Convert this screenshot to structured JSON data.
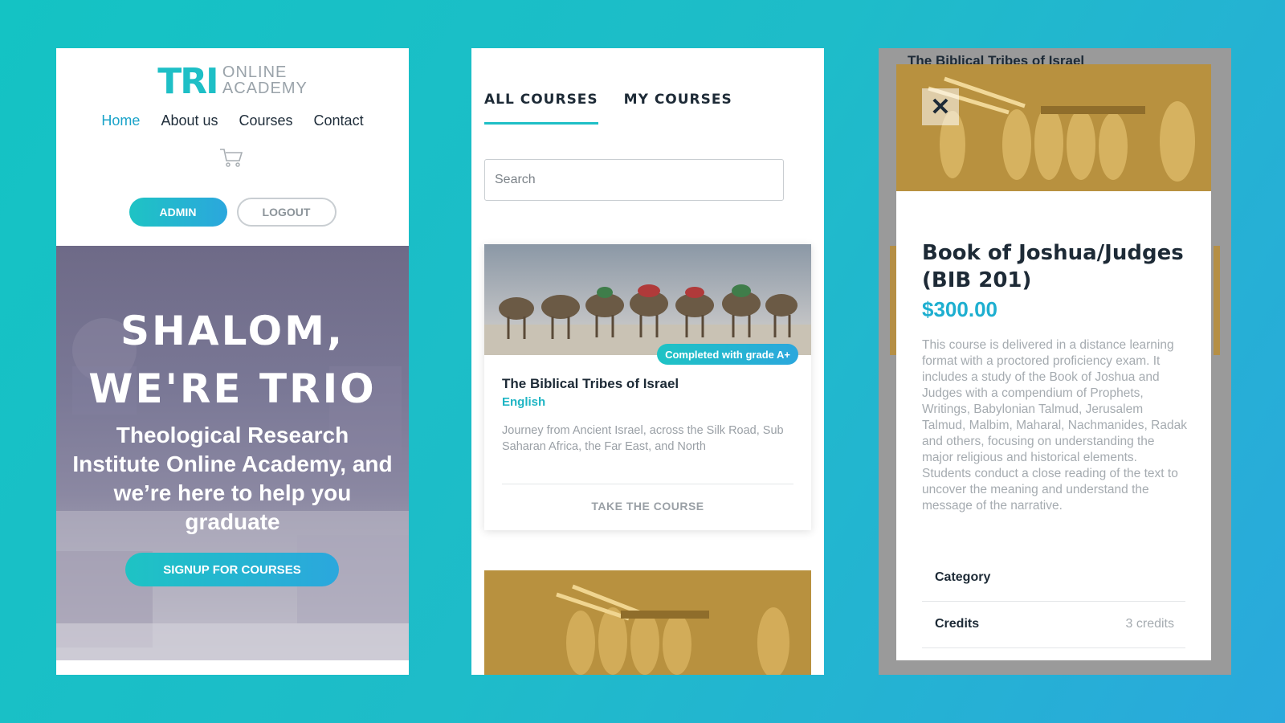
{
  "home": {
    "logo": {
      "mark": "TRI",
      "line1": "ONLINE",
      "line2": "ACADEMY"
    },
    "nav": [
      "Home",
      "About us",
      "Courses",
      "Contact"
    ],
    "admin_label": "ADMIN",
    "logout_label": "LOGOUT",
    "hero_title_1": "SHALOM,",
    "hero_title_2": "WE'RE TRIO",
    "hero_subtitle": "Theological Research Institute Online Academy, and we’re here to help you graduate",
    "cta_label": "SIGNUP FOR COURSES"
  },
  "courses": {
    "tabs": [
      "ALL COURSES",
      "MY COURSES"
    ],
    "search_placeholder": "Search",
    "card": {
      "badge": "Completed with grade A+",
      "title": "The Biblical Tribes of Israel",
      "language": "English",
      "description": "Journey from Ancient Israel, across the Silk Road, Sub Saharan Africa, the Far East, and North",
      "cta": "TAKE THE COURSE"
    }
  },
  "detail": {
    "background_title": "The Biblical Tribes of Israel",
    "close_symbol": "✕",
    "title": "Book of Joshua/Judges (BIB 201)",
    "price": "$300.00",
    "description": "This course is delivered in a distance learning format with a proctored proficiency exam. It includes a study of the Book of Joshua and Judges with a compendium of Prophets, Writings, Babylonian Talmud, Jerusalem Talmud, Malbim, Maharal, Nachmanides, Radak and others, focusing on understanding the major religious and historical elements. Students conduct a close reading of the text to uncover the meaning and understand the message of the narrative.",
    "rows": [
      {
        "key": "Category",
        "value": ""
      },
      {
        "key": "Credits",
        "value": "3 credits"
      }
    ]
  },
  "colors": {
    "accent": "#1ebfc6",
    "accent2": "#2ba7dd",
    "text": "#1d2a36",
    "muted": "#9aa0a6"
  },
  "icons": [
    "cart-icon",
    "close-icon"
  ]
}
